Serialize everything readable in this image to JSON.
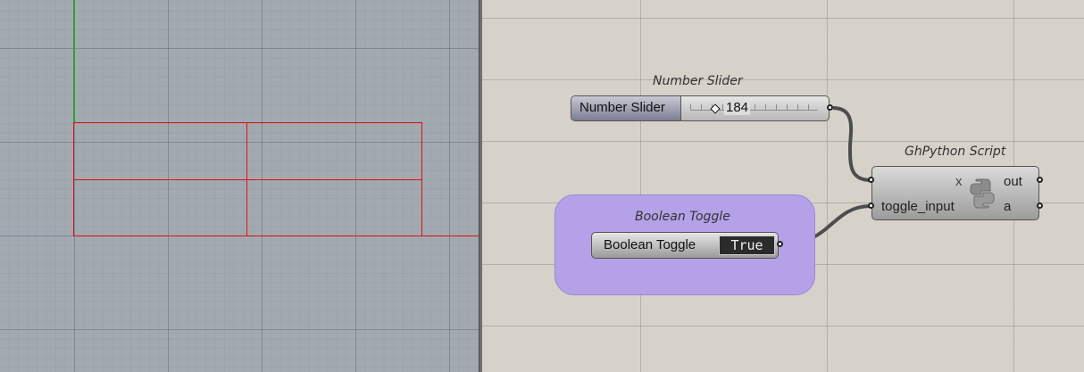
{
  "number_slider": {
    "title": "Number Slider",
    "label": "Number Slider",
    "value": "184"
  },
  "boolean_toggle": {
    "group_title": "Boolean Toggle",
    "label": "Boolean Toggle",
    "value": "True"
  },
  "ghpython": {
    "title": "GhPython Script",
    "input_x": "x",
    "input_toggle": "toggle_input",
    "output_out": "out",
    "output_a": "a"
  },
  "colors": {
    "rectangle": "#e01010",
    "group_fill": "#b5a1e8",
    "y_axis": "#2fa02f"
  }
}
